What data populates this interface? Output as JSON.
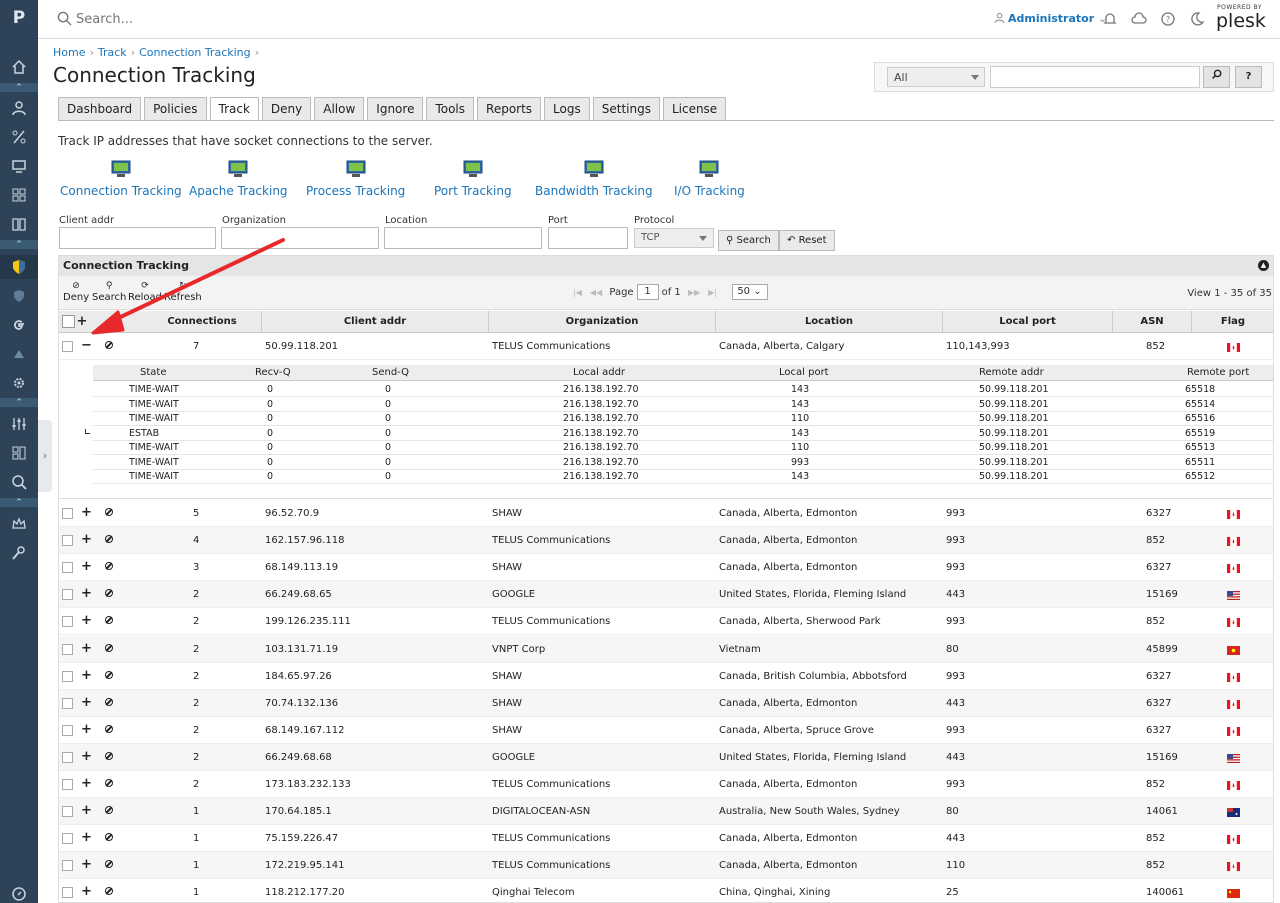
{
  "header": {
    "search_placeholder": "Search...",
    "user": "Administrator",
    "brand_small": "POWERED BY",
    "brand": "plesk"
  },
  "rail": {
    "logo": "P"
  },
  "breadcrumb": [
    "Home",
    "Track",
    "Connection Tracking"
  ],
  "page_title": "Connection Tracking",
  "top_filter": {
    "select_value": "All",
    "search_btn": "⚲",
    "help_btn": "?"
  },
  "tabs": [
    "Dashboard",
    "Policies",
    "Track",
    "Deny",
    "Allow",
    "Ignore",
    "Tools",
    "Reports",
    "Logs",
    "Settings",
    "License"
  ],
  "active_tab": "Track",
  "intro": "Track IP addresses that have socket connections to the server.",
  "icon_links": [
    "Connection Tracking",
    "Apache Tracking",
    "Process Tracking",
    "Port Tracking",
    "Bandwidth Tracking",
    "I/O Tracking"
  ],
  "form": {
    "labels": {
      "client": "Client addr",
      "org": "Organization",
      "loc": "Location",
      "port": "Port",
      "protocol": "Protocol"
    },
    "protocol_value": "TCP",
    "search_btn": "Search",
    "reset_btn": "Reset"
  },
  "grid": {
    "title": "Connection Tracking",
    "toolbar": {
      "deny": "Deny",
      "search": "Search",
      "reload": "Reload",
      "refresh": "Refresh"
    },
    "pager": {
      "page_label": "Page",
      "page": "1",
      "of": "of 1",
      "per_page": "50"
    },
    "view_count": "View 1 - 35 of 35",
    "columns": [
      "+",
      "Connections",
      "Client addr",
      "Organization",
      "Location",
      "Local port",
      "ASN",
      "Flag"
    ],
    "expanded_row": {
      "conn": "7",
      "ip": "50.99.118.201",
      "org": "TELUS Communications",
      "loc": "Canada, Alberta, Calgary",
      "port": "110,143,993",
      "asn": "852",
      "flag": "ca"
    },
    "sub_columns": [
      "State",
      "Recv-Q",
      "Send-Q",
      "Local addr",
      "Local port",
      "Remote addr",
      "Remote port"
    ],
    "sub_rows": [
      [
        "TIME-WAIT",
        "0",
        "0",
        "216.138.192.70",
        "143",
        "50.99.118.201",
        "65518"
      ],
      [
        "TIME-WAIT",
        "0",
        "0",
        "216.138.192.70",
        "143",
        "50.99.118.201",
        "65514"
      ],
      [
        "TIME-WAIT",
        "0",
        "0",
        "216.138.192.70",
        "110",
        "50.99.118.201",
        "65516"
      ],
      [
        "ESTAB",
        "0",
        "0",
        "216.138.192.70",
        "143",
        "50.99.118.201",
        "65519"
      ],
      [
        "TIME-WAIT",
        "0",
        "0",
        "216.138.192.70",
        "110",
        "50.99.118.201",
        "65513"
      ],
      [
        "TIME-WAIT",
        "0",
        "0",
        "216.138.192.70",
        "993",
        "50.99.118.201",
        "65511"
      ],
      [
        "TIME-WAIT",
        "0",
        "0",
        "216.138.192.70",
        "143",
        "50.99.118.201",
        "65512"
      ]
    ],
    "rows": [
      {
        "conn": "5",
        "ip": "96.52.70.9",
        "org": "SHAW",
        "loc": "Canada, Alberta, Edmonton",
        "port": "993",
        "asn": "6327",
        "flag": "ca"
      },
      {
        "conn": "4",
        "ip": "162.157.96.118",
        "org": "TELUS Communications",
        "loc": "Canada, Alberta, Edmonton",
        "port": "993",
        "asn": "852",
        "flag": "ca"
      },
      {
        "conn": "3",
        "ip": "68.149.113.19",
        "org": "SHAW",
        "loc": "Canada, Alberta, Edmonton",
        "port": "993",
        "asn": "6327",
        "flag": "ca"
      },
      {
        "conn": "2",
        "ip": "66.249.68.65",
        "org": "GOOGLE",
        "loc": "United States, Florida, Fleming Island",
        "port": "443",
        "asn": "15169",
        "flag": "us"
      },
      {
        "conn": "2",
        "ip": "199.126.235.111",
        "org": "TELUS Communications",
        "loc": "Canada, Alberta, Sherwood Park",
        "port": "993",
        "asn": "852",
        "flag": "ca"
      },
      {
        "conn": "2",
        "ip": "103.131.71.19",
        "org": "VNPT Corp",
        "loc": "Vietnam",
        "port": "80",
        "asn": "45899",
        "flag": "vn"
      },
      {
        "conn": "2",
        "ip": "184.65.97.26",
        "org": "SHAW",
        "loc": "Canada, British Columbia, Abbotsford",
        "port": "993",
        "asn": "6327",
        "flag": "ca"
      },
      {
        "conn": "2",
        "ip": "70.74.132.136",
        "org": "SHAW",
        "loc": "Canada, Alberta, Edmonton",
        "port": "443",
        "asn": "6327",
        "flag": "ca"
      },
      {
        "conn": "2",
        "ip": "68.149.167.112",
        "org": "SHAW",
        "loc": "Canada, Alberta, Spruce Grove",
        "port": "993",
        "asn": "6327",
        "flag": "ca"
      },
      {
        "conn": "2",
        "ip": "66.249.68.68",
        "org": "GOOGLE",
        "loc": "United States, Florida, Fleming Island",
        "port": "443",
        "asn": "15169",
        "flag": "us"
      },
      {
        "conn": "2",
        "ip": "173.183.232.133",
        "org": "TELUS Communications",
        "loc": "Canada, Alberta, Edmonton",
        "port": "993",
        "asn": "852",
        "flag": "ca"
      },
      {
        "conn": "1",
        "ip": "170.64.185.1",
        "org": "DIGITALOCEAN-ASN",
        "loc": "Australia, New South Wales, Sydney",
        "port": "80",
        "asn": "14061",
        "flag": "au"
      },
      {
        "conn": "1",
        "ip": "75.159.226.47",
        "org": "TELUS Communications",
        "loc": "Canada, Alberta, Edmonton",
        "port": "443",
        "asn": "852",
        "flag": "ca"
      },
      {
        "conn": "1",
        "ip": "172.219.95.141",
        "org": "TELUS Communications",
        "loc": "Canada, Alberta, Edmonton",
        "port": "110",
        "asn": "852",
        "flag": "ca"
      },
      {
        "conn": "1",
        "ip": "118.212.177.20",
        "org": "Qinghai Telecom",
        "loc": "China, Qinghai, Xining",
        "port": "25",
        "asn": "140061",
        "flag": "cn"
      }
    ]
  },
  "colors": {
    "rail": "#2e4358",
    "link": "#1b75bb",
    "arrow": "#e8292b"
  }
}
